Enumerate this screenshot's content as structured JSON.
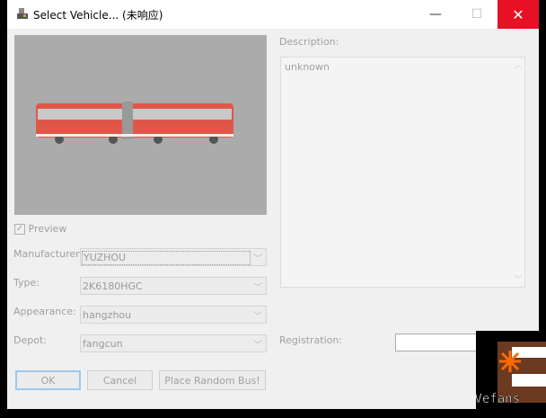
{
  "window": {
    "title": "Select Vehicle... (未响应)",
    "minimize": "—",
    "maximize": "☐",
    "close": "✕"
  },
  "preview": {
    "checkbox_label": "Preview",
    "checked": true
  },
  "form": {
    "manufacturer_label": "Manufacturer:",
    "manufacturer": "YUZHOU",
    "type_label": "Type:",
    "type": "2K6180HGC",
    "appearance_label": "Appearance:",
    "appearance": "hangzhou",
    "depot_label": "Depot:",
    "depot": "fangcun"
  },
  "buttons": {
    "ok": "OK",
    "cancel": "Cancel",
    "random": "Place Random Bus!"
  },
  "description": {
    "label": "Description:",
    "text": "unknown"
  },
  "registration": {
    "label": "Registration:",
    "value": ""
  },
  "watermark": "@Vefans",
  "colors": {
    "close": "#e81123",
    "bus": "#e0574a"
  }
}
